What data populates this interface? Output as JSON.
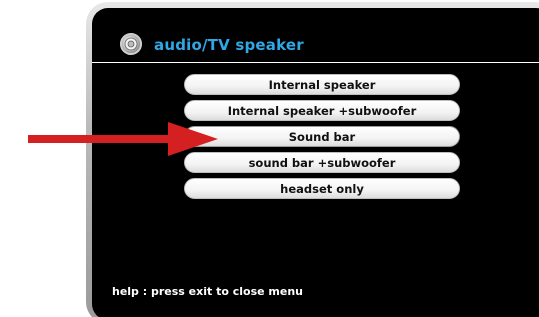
{
  "header": {
    "title": "audio/TV speaker",
    "icon": "speaker-icon"
  },
  "menu": {
    "items": [
      {
        "label": "Internal speaker"
      },
      {
        "label": "Internal speaker +subwoofer"
      },
      {
        "label": "Sound bar"
      },
      {
        "label": "sound bar +subwoofer"
      },
      {
        "label": "headset only"
      }
    ],
    "selected_index": 2
  },
  "help": {
    "text": "help : press exit to close menu"
  },
  "annotation": {
    "icon": "red-arrow-icon",
    "color": "#d42020"
  },
  "colors": {
    "title": "#2fa8e6",
    "screen": "#000000",
    "button": "#ffffff"
  }
}
